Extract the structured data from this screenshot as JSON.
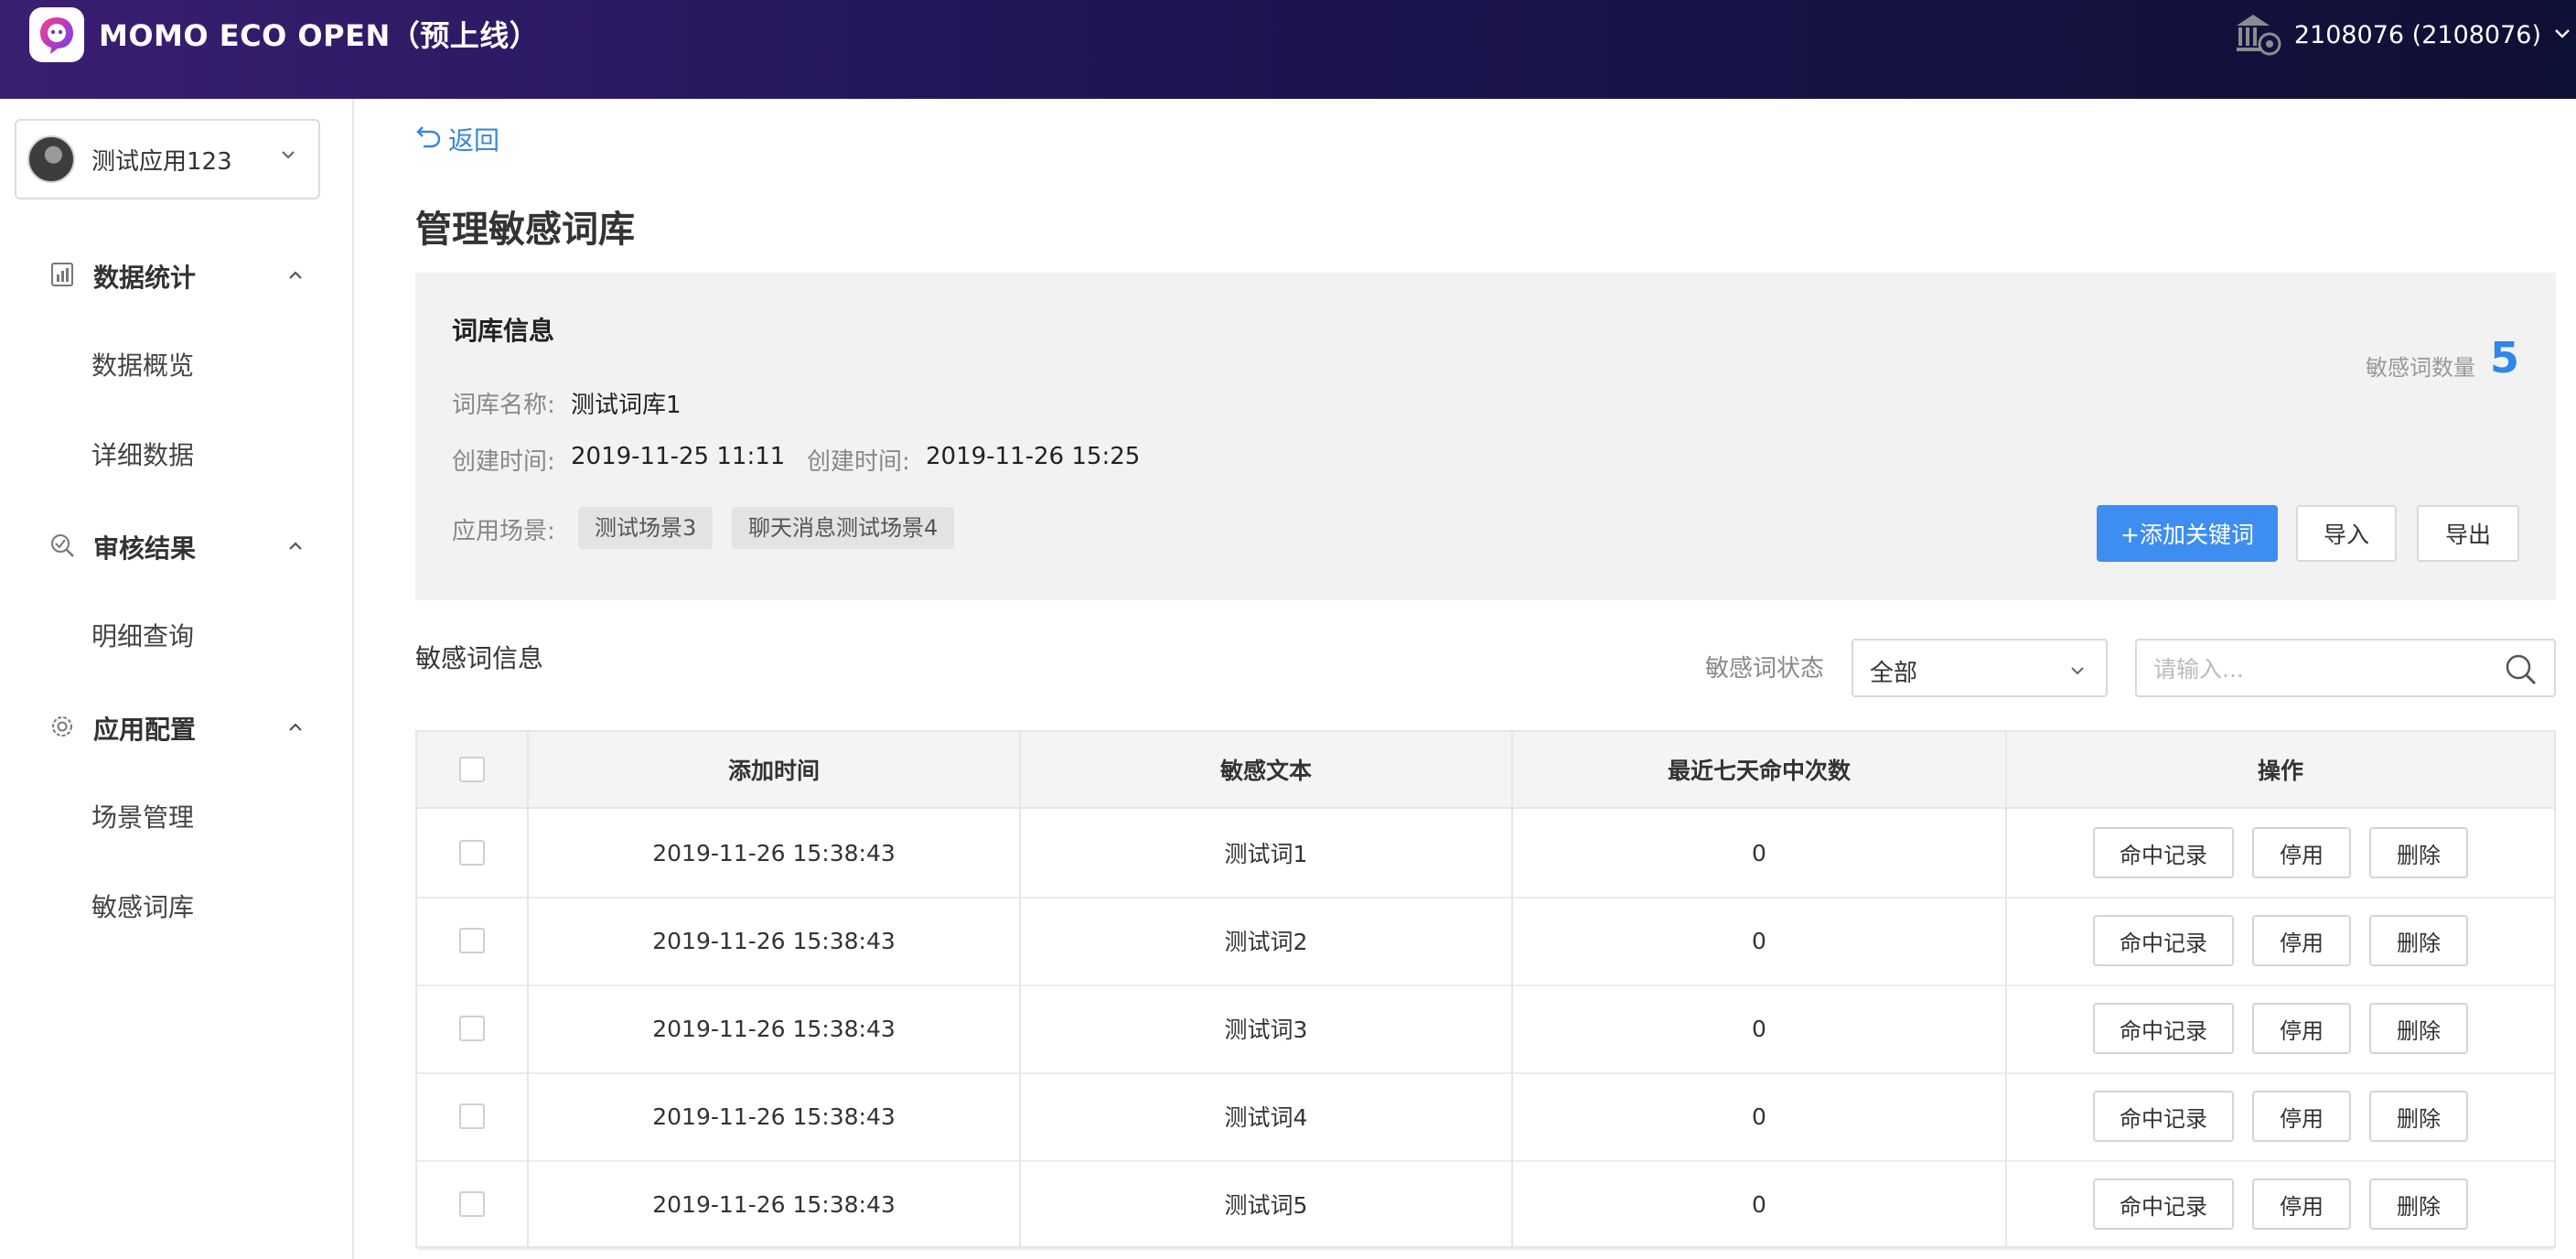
{
  "header": {
    "app_title": "MOMO ECO OPEN（预上线）",
    "account": "2108076 (2108076)"
  },
  "sidebar": {
    "app_name": "测试应用123",
    "groups": [
      {
        "label": "数据统计",
        "items": [
          "数据概览",
          "详细数据"
        ]
      },
      {
        "label": "审核结果",
        "items": [
          "明细查询"
        ]
      },
      {
        "label": "应用配置",
        "items": [
          "场景管理",
          "敏感词库"
        ]
      }
    ]
  },
  "main": {
    "back_label": "返回",
    "page_title": "管理敏感词库",
    "info": {
      "section_title": "词库信息",
      "name_label": "词库名称:",
      "name_value": "测试词库1",
      "created_label": "创建时间:",
      "created_value": "2019-11-25 11:11",
      "updated_label": "创建时间:",
      "updated_value": "2019-11-26 15:25",
      "scene_label": "应用场景:",
      "scenes": [
        "测试场景3",
        "聊天消息测试场景4"
      ],
      "count_label": "敏感词数量",
      "count_value": "5",
      "add_button": "+添加关键词",
      "import_button": "导入",
      "export_button": "导出"
    },
    "words": {
      "section_title": "敏感词信息",
      "status_label": "敏感词状态",
      "status_value": "全部",
      "search_placeholder": "请输入...",
      "columns": [
        "添加时间",
        "敏感文本",
        "最近七天命中次数",
        "操作"
      ],
      "rows": [
        {
          "time": "2019-11-26 15:38:43",
          "text": "测试词1",
          "hits": "0"
        },
        {
          "time": "2019-11-26 15:38:43",
          "text": "测试词2",
          "hits": "0"
        },
        {
          "time": "2019-11-26 15:38:43",
          "text": "测试词3",
          "hits": "0"
        },
        {
          "time": "2019-11-26 15:38:43",
          "text": "测试词4",
          "hits": "0"
        },
        {
          "time": "2019-11-26 15:38:43",
          "text": "测试词5",
          "hits": "0"
        }
      ],
      "row_actions": [
        "命中记录",
        "停用",
        "删除"
      ]
    }
  },
  "colors": {
    "accent": "#3d8ef0",
    "header_start": "#3a1e72",
    "header_end": "#0f1035"
  }
}
